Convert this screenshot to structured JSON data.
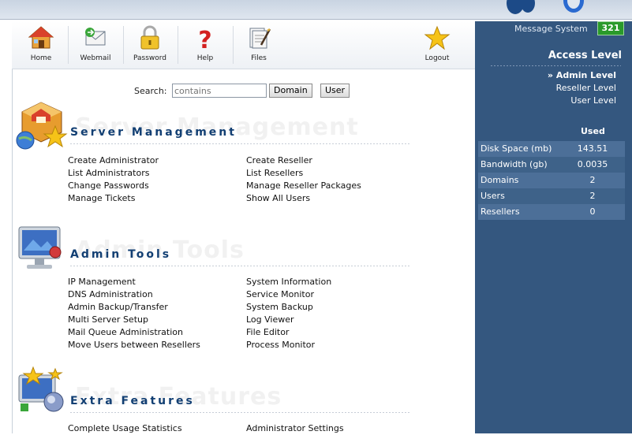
{
  "toolbar": {
    "items": [
      {
        "label": "Home",
        "icon": "home-icon"
      },
      {
        "label": "Webmail",
        "icon": "webmail-icon"
      },
      {
        "label": "Password",
        "icon": "padlock-icon"
      },
      {
        "label": "Help",
        "icon": "question-icon"
      },
      {
        "label": "Files",
        "icon": "files-icon"
      },
      {
        "label": "Logout",
        "icon": "star-icon"
      }
    ]
  },
  "search": {
    "label": "Search:",
    "placeholder": "contains",
    "domain_button": "Domain",
    "user_button": "User"
  },
  "sections": {
    "server": {
      "title": "Server Management",
      "ghost": "Server Management",
      "left": [
        "Create Administrator",
        "List Administrators",
        "Change Passwords",
        "Manage Tickets"
      ],
      "right": [
        "Create Reseller",
        "List Resellers",
        "Manage Reseller Packages",
        "Show All Users"
      ]
    },
    "admin": {
      "title": "Admin Tools",
      "ghost": "Admin Tools",
      "left": [
        "IP Management",
        "DNS Administration",
        "Admin Backup/Transfer",
        "Multi Server Setup",
        "Mail Queue Administration",
        "Move Users between Resellers"
      ],
      "right": [
        "System Information",
        "Service Monitor",
        "System Backup",
        "Log Viewer",
        "File Editor",
        "Process Monitor"
      ]
    },
    "extra": {
      "title": "Extra Features",
      "ghost": "Extra Features",
      "left": [
        "Complete Usage Statistics"
      ],
      "right": [
        "Administrator Settings"
      ]
    }
  },
  "sidebar": {
    "message_label": "Message System",
    "message_count": "321",
    "access_title": "Access Level",
    "levels": [
      "» Admin Level",
      "Reseller Level",
      "User Level"
    ],
    "used_header": "Used",
    "stats": [
      {
        "label": "Disk Space (mb)",
        "value": "143.51"
      },
      {
        "label": "Bandwidth (gb)",
        "value": "0.0035"
      },
      {
        "label": "Domains",
        "value": "2"
      },
      {
        "label": "Users",
        "value": "2"
      },
      {
        "label": "Resellers",
        "value": "0"
      }
    ]
  },
  "colors": {
    "sidebar": "#34577f",
    "section_title": "#123f73",
    "badge": "#2a9a2a"
  }
}
